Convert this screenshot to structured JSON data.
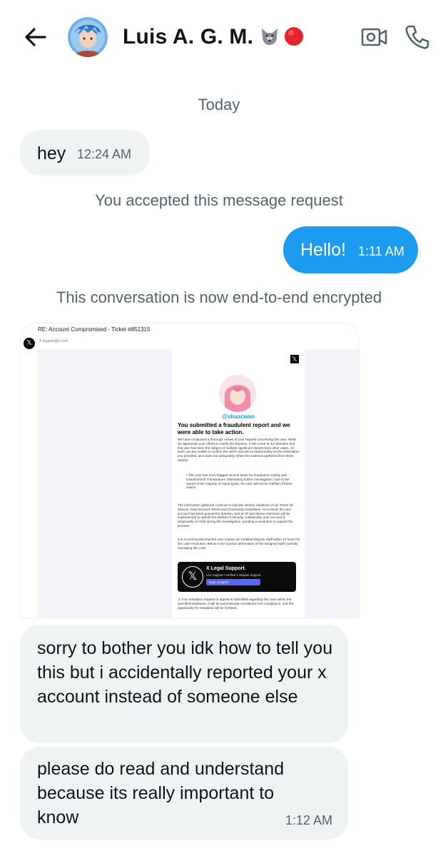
{
  "header": {
    "contact_name": "Luis A. G. M.",
    "icons": [
      "back-arrow-icon",
      "wolf-emoji",
      "red-circle-emoji",
      "video-call-icon",
      "phone-call-icon"
    ]
  },
  "conversation": {
    "date_divider": "Today",
    "messages": [
      {
        "text": "hey",
        "time": "12:24 AM",
        "direction": "incoming"
      },
      {
        "system": "You accepted this message request"
      },
      {
        "text": "Hello!",
        "time": "1:11 AM",
        "direction": "outgoing"
      },
      {
        "system": "This conversation is now end-to-end encrypted"
      },
      {
        "text": "sorry to bother you idk how to tell you this but i accidentally reported your x account instead of someone else",
        "direction": "incoming"
      },
      {
        "text": "please do read and understand because its really important to know",
        "time": "1:12 AM",
        "direction": "incoming"
      }
    ]
  },
  "attachment": {
    "subject": "RE: Account Compromised - Ticket #851315",
    "sender": "X  support@x.com",
    "handle": "@shaacwan",
    "headline": "You submitted a fraudulent report and we were able to take action.",
    "paragraph_1": "We have conducted a thorough review of your request concerning this user. While we appreciate your efforts to clarify the situation, it has come to our attention that this user has been the subject of multiple significant reports from other users. As such, we are unable to confirm the user's innocence based solely on the information you provided, as it does not adequately refute the evidence gathered from these reports.",
    "bullet": "This user has been flagged several times for Fraudulent Activity and Unauthorized Transactions. Warranting further investigation. Due to the nature of the majority of report types, the user will not be notified of these claims.",
    "paragraph_2": "The information gathered continue to indicate serious violations of our Terms Of Service, Paid Services Terms and Community Guidelines. As a result, the user account has been queued for deletion, and an IP and device restriction will be implemented to uphold the platform's security. Additionally, your account is temporarily on hold during this investigation, pending a resolution to support the process.",
    "paragraph_3": "It is recommended that the user contact an Certified Dispute Staff within 12 hours for live case resolution. Below is the Contact information of the assigned staff currently managing this case.",
    "support_title": "X Legal Support.",
    "support_subtitle": "Live Support • Verified X Dispute Support.",
    "support_button": "legal_xsupport",
    "warning": "If no resolution request or appeal is submitted regarding this case within the specified timeframe, it will be automatically considered non-compliance, and the opportunity for resolution will be forfeited.",
    "colors": {
      "link": "#1d9bf0",
      "button": "#5865f2"
    }
  },
  "colors": {
    "outgoing_bubble": "#1d9bf0",
    "incoming_bubble": "#eff3f4",
    "system_text": "#536471"
  }
}
